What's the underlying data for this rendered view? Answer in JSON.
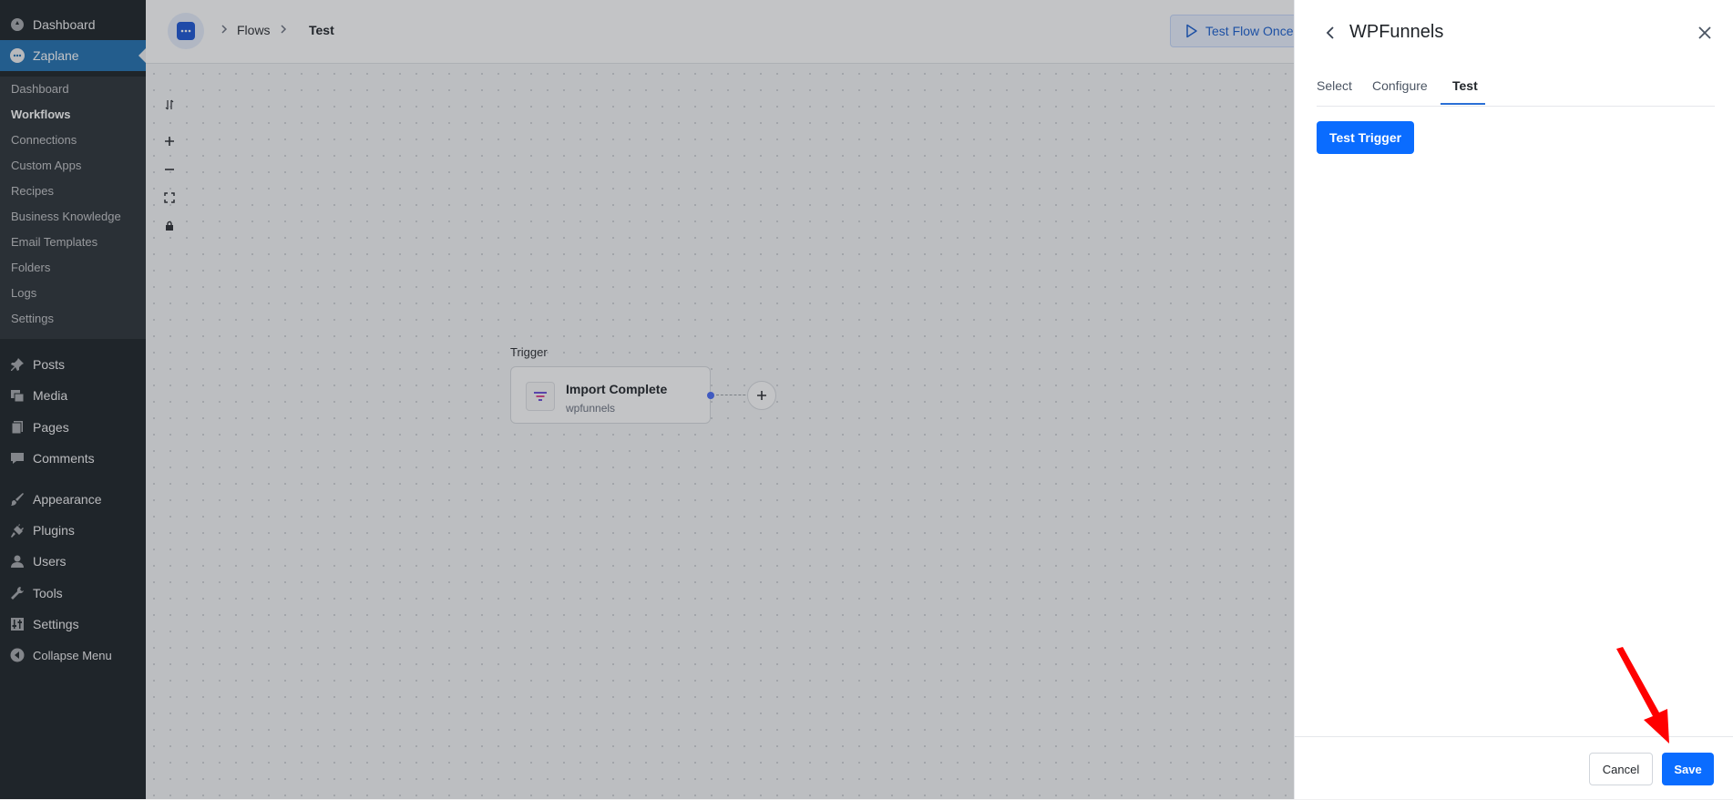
{
  "wp_menu": {
    "top_items": [
      {
        "label": "Dashboard",
        "icon": "dashboard-icon"
      },
      {
        "label": "Zaplane",
        "icon": "zaplane-icon"
      }
    ],
    "zaplane_submenu": [
      {
        "label": "Dashboard"
      },
      {
        "label": "Workflows",
        "current": true
      },
      {
        "label": "Connections"
      },
      {
        "label": "Custom Apps"
      },
      {
        "label": "Recipes"
      },
      {
        "label": "Business Knowledge"
      },
      {
        "label": "Email Templates"
      },
      {
        "label": "Folders"
      },
      {
        "label": "Logs"
      },
      {
        "label": "Settings"
      }
    ],
    "items": [
      {
        "label": "Posts",
        "icon": "pushpin-icon"
      },
      {
        "label": "Media",
        "icon": "media-icon"
      },
      {
        "label": "Pages",
        "icon": "pages-icon"
      },
      {
        "label": "Comments",
        "icon": "comment-icon"
      },
      {
        "label": "Appearance",
        "icon": "paintbrush-icon"
      },
      {
        "label": "Plugins",
        "icon": "plug-icon"
      },
      {
        "label": "Users",
        "icon": "user-icon"
      },
      {
        "label": "Tools",
        "icon": "wrench-icon"
      },
      {
        "label": "Settings",
        "icon": "settings-sliders-icon"
      },
      {
        "label": "Collapse Menu",
        "icon": "collapse-arrow-icon"
      }
    ]
  },
  "topbar": {
    "breadcrumb": [
      "Flows",
      "Test"
    ],
    "test_flow_button": "Test Flow Once"
  },
  "canvas": {
    "trigger_label": "Trigger",
    "node": {
      "title": "Import Complete",
      "subtitle": "wpfunnels"
    }
  },
  "drawer": {
    "title": "WPFunnels",
    "tabs": [
      {
        "label": "Select"
      },
      {
        "label": "Configure"
      },
      {
        "label": "Test",
        "active": true
      }
    ],
    "test_trigger_button": "Test Trigger",
    "cancel_button": "Cancel",
    "save_button": "Save"
  },
  "colors": {
    "primary": "#0a6cff",
    "wp_sidebar": "#1d2327",
    "wp_active": "#2271b1",
    "annotation_arrow": "#ff0000"
  }
}
